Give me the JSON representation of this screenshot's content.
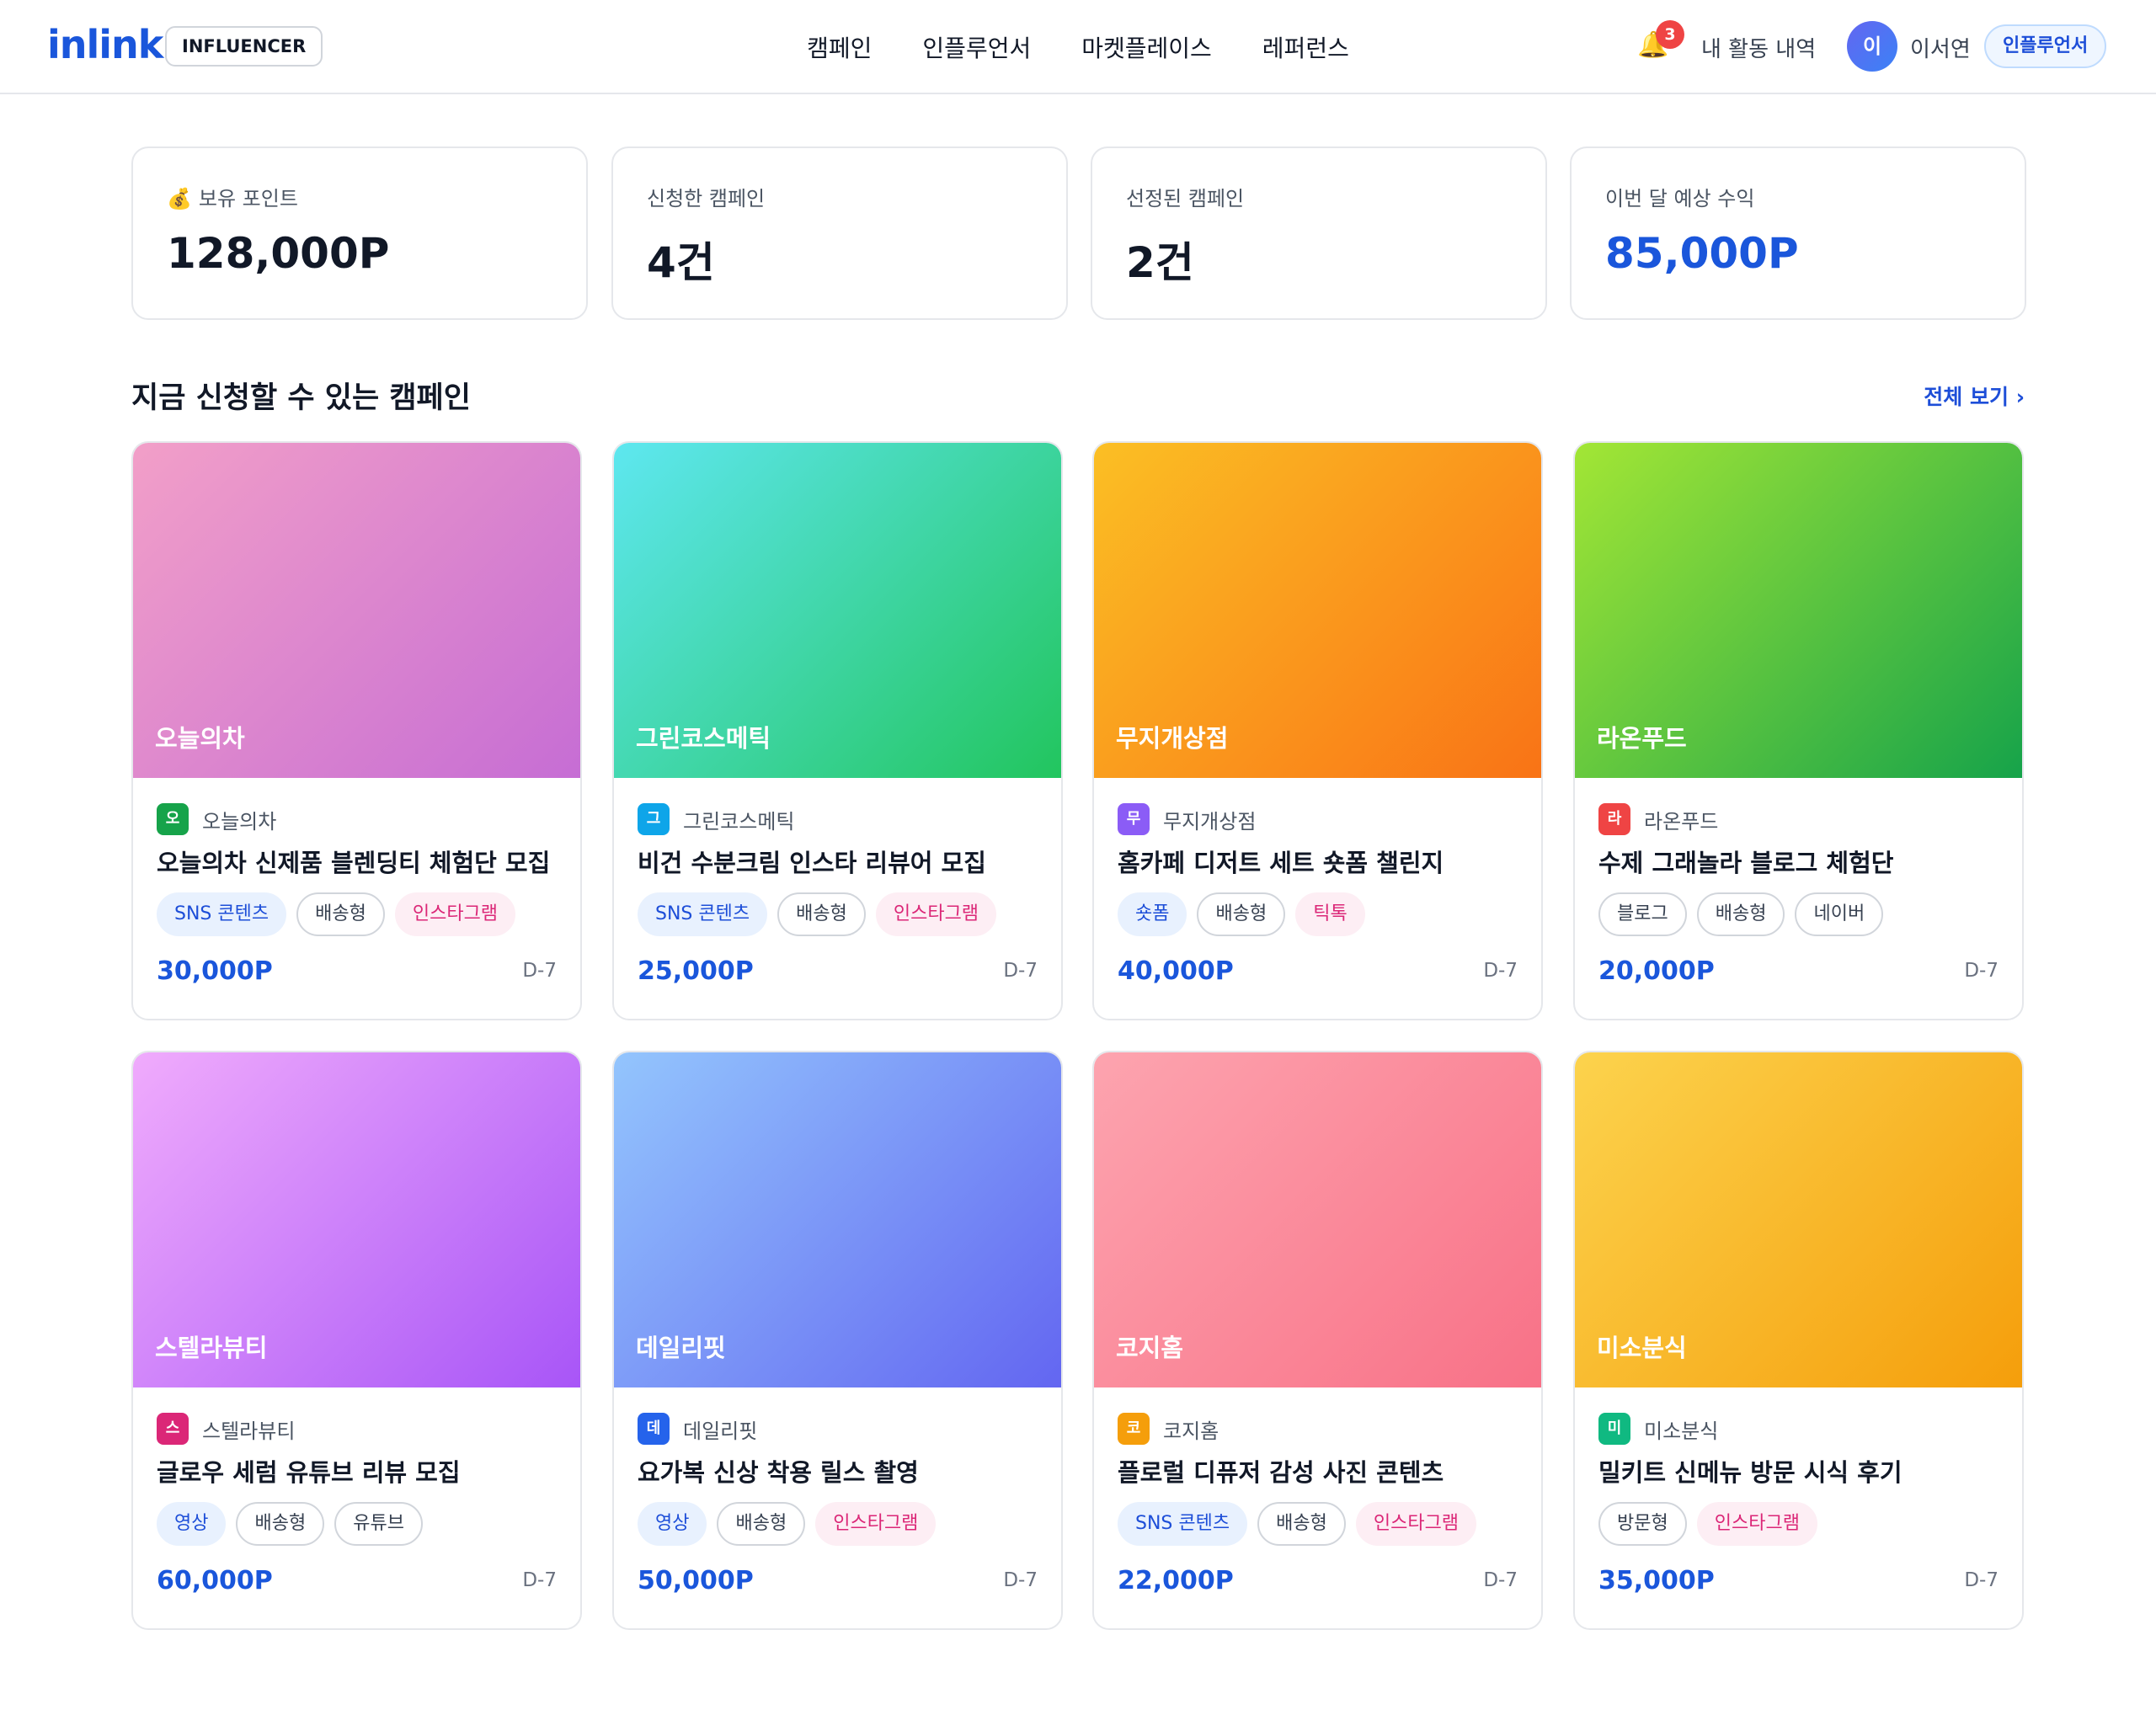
{
  "header": {
    "logo": "inlink",
    "role_badge": "INFLUENCER",
    "nav": [
      "캠페인",
      "인플루언서",
      "마켓플레이스",
      "레퍼런스"
    ],
    "notification_count": "3",
    "activity_link": "내 활동 내역",
    "avatar_initial": "이",
    "username": "이서연",
    "user_role": "인플루언서"
  },
  "stats": [
    {
      "icon": "💰",
      "label": "보유 포인트",
      "value": "128,000P",
      "accent": false
    },
    {
      "icon": "",
      "label": "신청한 캠페인",
      "value": "4건",
      "accent": false
    },
    {
      "icon": "",
      "label": "선정된 캠페인",
      "value": "2건",
      "accent": false
    },
    {
      "icon": "",
      "label": "이번 달 예상 수익",
      "value": "85,000P",
      "accent": true
    }
  ],
  "section": {
    "title": "지금 신청할 수 있는 캠페인",
    "view_all": "전체 보기 ›"
  },
  "campaigns": [
    {
      "brand": "오늘의차",
      "logo": "오",
      "logo_color": "#16a34a",
      "title": "오늘의차 신제품 블렌딩티 체험단 모집",
      "tags": [
        {
          "text": "SNS 콘텐츠",
          "style": "blue"
        },
        {
          "text": "배송형",
          "style": "gray"
        },
        {
          "text": "인스타그램",
          "style": "pink"
        }
      ],
      "price": "30,000P",
      "dday": "D-7",
      "gradient": [
        "#f29fc8",
        "#c66dd4"
      ]
    },
    {
      "brand": "그린코스메틱",
      "logo": "그",
      "logo_color": "#0ea5e9",
      "title": "비건 수분크림 인스타 리뷰어 모집",
      "tags": [
        {
          "text": "SNS 콘텐츠",
          "style": "blue"
        },
        {
          "text": "배송형",
          "style": "gray"
        },
        {
          "text": "인스타그램",
          "style": "pink"
        }
      ],
      "price": "25,000P",
      "dday": "D-7",
      "gradient": [
        "#5ee7f0",
        "#22c55e"
      ]
    },
    {
      "brand": "무지개상점",
      "logo": "무",
      "logo_color": "#8b5cf6",
      "title": "홈카페 디저트 세트 숏폼 챌린지",
      "tags": [
        {
          "text": "숏폼",
          "style": "blue"
        },
        {
          "text": "배송형",
          "style": "gray"
        },
        {
          "text": "틱톡",
          "style": "pink"
        }
      ],
      "price": "40,000P",
      "dday": "D-7",
      "gradient": [
        "#fbbf24",
        "#f97316"
      ]
    },
    {
      "brand": "라온푸드",
      "logo": "라",
      "logo_color": "#ef4444",
      "title": "수제 그래놀라 블로그 체험단",
      "tags": [
        {
          "text": "블로그",
          "style": "gray"
        },
        {
          "text": "배송형",
          "style": "gray"
        },
        {
          "text": "네이버",
          "style": "gray"
        }
      ],
      "price": "20,000P",
      "dday": "D-7",
      "gradient": [
        "#a3e635",
        "#16a34a"
      ]
    },
    {
      "brand": "스텔라뷰티",
      "logo": "스",
      "logo_color": "#db2777",
      "title": "글로우 세럼 유튜브 리뷰 모집",
      "tags": [
        {
          "text": "영상",
          "style": "blue"
        },
        {
          "text": "배송형",
          "style": "gray"
        },
        {
          "text": "유튜브",
          "style": "gray"
        }
      ],
      "price": "60,000P",
      "dday": "D-7",
      "gradient": [
        "#f0abfc",
        "#a855f7"
      ]
    },
    {
      "brand": "데일리핏",
      "logo": "데",
      "logo_color": "#2563eb",
      "title": "요가복 신상 착용 릴스 촬영",
      "tags": [
        {
          "text": "영상",
          "style": "blue"
        },
        {
          "text": "배송형",
          "style": "gray"
        },
        {
          "text": "인스타그램",
          "style": "pink"
        }
      ],
      "price": "50,000P",
      "dday": "D-7",
      "gradient": [
        "#93c5fd",
        "#6366f1"
      ]
    },
    {
      "brand": "코지홈",
      "logo": "코",
      "logo_color": "#f59e0b",
      "title": "플로럴 디퓨저 감성 사진 콘텐츠",
      "tags": [
        {
          "text": "SNS 콘텐츠",
          "style": "blue"
        },
        {
          "text": "배송형",
          "style": "gray"
        },
        {
          "text": "인스타그램",
          "style": "pink"
        }
      ],
      "price": "22,000P",
      "dday": "D-7",
      "gradient": [
        "#fda4af",
        "#f87187"
      ]
    },
    {
      "brand": "미소분식",
      "logo": "미",
      "logo_color": "#10b981",
      "title": "밀키트 신메뉴 방문 시식 후기",
      "tags": [
        {
          "text": "방문형",
          "style": "gray"
        },
        {
          "text": "인스타그램",
          "style": "pink"
        }
      ],
      "price": "35,000P",
      "dday": "D-7",
      "gradient": [
        "#fcd34d",
        "#f59e0b"
      ]
    }
  ]
}
